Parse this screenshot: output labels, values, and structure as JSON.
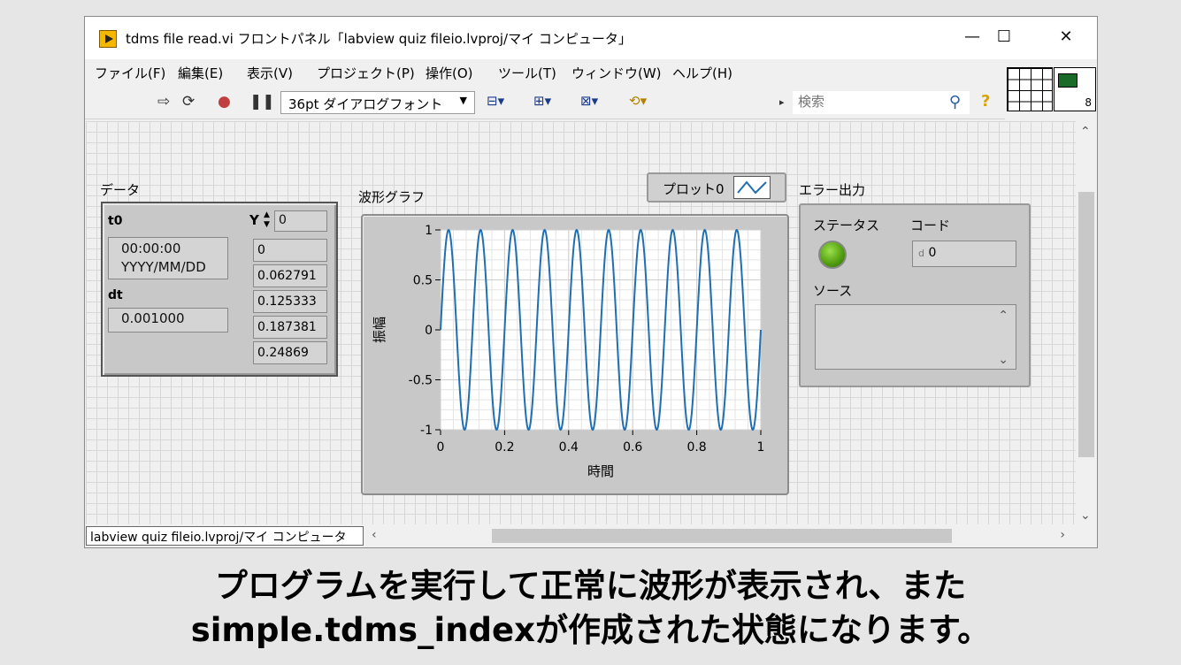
{
  "window": {
    "title": "tdms file read.vi フロントパネル「labview quiz fileio.lvproj/マイ コンピュータ」",
    "minimize": "—",
    "maximize": "☐",
    "close": "✕"
  },
  "menu": [
    "ファイル(F)",
    "編集(E)",
    "表示(V)",
    "プロジェクト(P)",
    "操作(O)",
    "ツール(T)",
    "ウィンドウ(W)",
    "ヘルプ(H)"
  ],
  "toolbar": {
    "font": "36pt ダイアログフォント",
    "search_placeholder": "検索",
    "help": "?"
  },
  "connector_pane": {
    "number": "8"
  },
  "data_cluster": {
    "label": "データ",
    "t0_label": "t0",
    "t0_time": "00:00:00",
    "t0_date": "YYYY/MM/DD",
    "dt_label": "dt",
    "dt_value": "0.001000",
    "y_label": "Y",
    "y_index": "0",
    "y_values": [
      "0",
      "0.062791",
      "0.125333",
      "0.187381",
      "0.24869"
    ]
  },
  "graph": {
    "label": "波形グラフ",
    "legend": "プロット0",
    "line_color": "#1f6fb2"
  },
  "chart_data": {
    "type": "line",
    "title": "波形グラフ",
    "xlabel": "時間",
    "ylabel": "振幅",
    "xlim": [
      0,
      1
    ],
    "ylim": [
      -1,
      1
    ],
    "x_ticks": [
      "0",
      "0.2",
      "0.4",
      "0.6",
      "0.8",
      "1"
    ],
    "y_ticks": [
      "1",
      "0.5",
      "0",
      "-0.5",
      "-1"
    ],
    "grid": true,
    "series": [
      {
        "name": "プロット0",
        "function": "sin(2*pi*10*t)",
        "frequency": 10,
        "amplitude": 1
      }
    ]
  },
  "error_out": {
    "label": "エラー出力",
    "status_label": "ステータス",
    "code_label": "コード",
    "code_prefix": "d",
    "code_value": "0",
    "source_label": "ソース"
  },
  "status_bar": {
    "project": "labview quiz fileio.lvproj/マイ コンピュータ"
  },
  "caption": {
    "line1": "プログラムを実行して正常に波形が表示され、また",
    "line2": "simple.tdms_indexが作成された状態になります。"
  }
}
